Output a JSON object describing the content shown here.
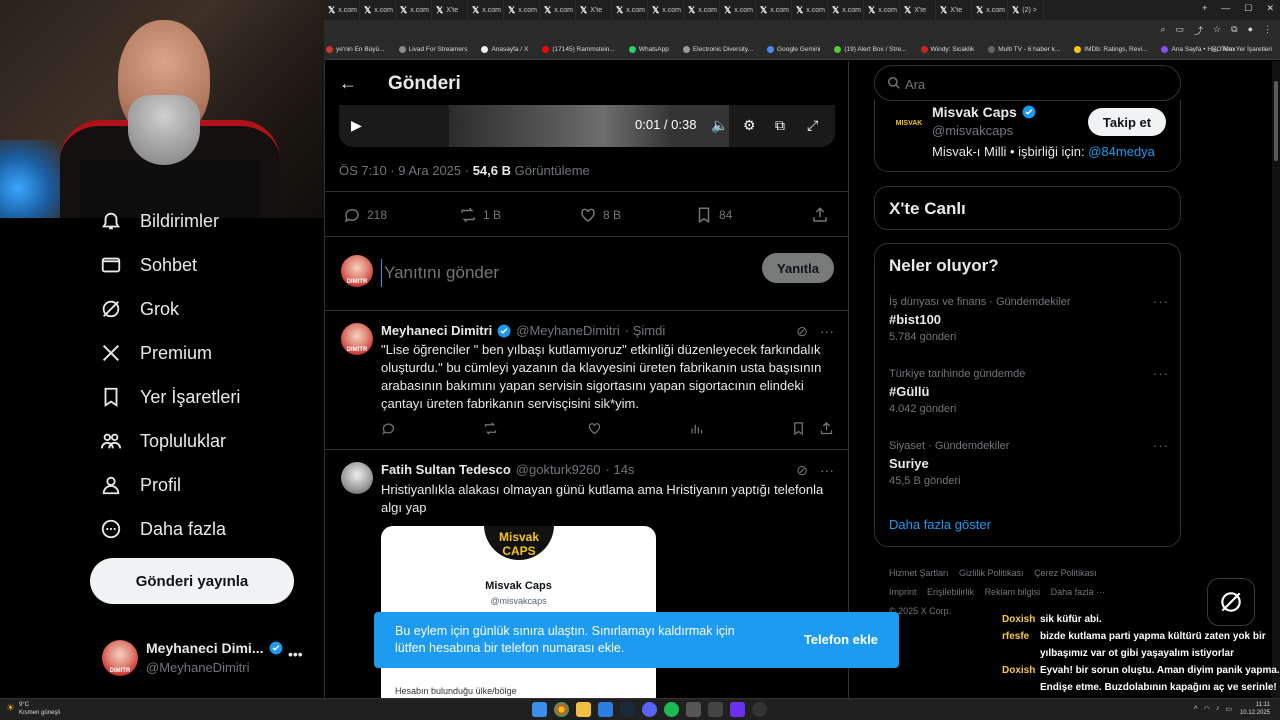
{
  "browser": {
    "tabs": [
      "x.com",
      "x.com",
      "x.com",
      "X'te",
      "x.com",
      "x.com",
      "x.com",
      "X'te",
      "x.com",
      "x.com",
      "x.com",
      "x.com",
      "x.com",
      "x.com",
      "x.com",
      "x.com",
      "X'te",
      "X'te",
      "x.com",
      "(2) >"
    ],
    "bookmarks": [
      "ye'nin En Büyü...",
      "Livad For Streamers",
      "Anasayfa / X",
      "(17145) Rammstein...",
      "WhatsApp",
      "Electronic Diversity...",
      "Google Gemini",
      "(19) Alert Box / Stre...",
      "Windy: Sicaklik",
      "Multi TV - 6 haber k...",
      "IMDb: Ratings, Revi...",
      "Ana Sayfa • HBO Max"
    ],
    "all_bookmarks": "Tüm Yer İşaretleri"
  },
  "sidebar": {
    "items": [
      {
        "label": "Bildirimler",
        "icon": "bell-icon"
      },
      {
        "label": "Sohbet",
        "icon": "mail-icon"
      },
      {
        "label": "Grok",
        "icon": "grok-icon"
      },
      {
        "label": "Premium",
        "icon": "x-logo-icon"
      },
      {
        "label": "Yer İşaretleri",
        "icon": "bookmark-icon"
      },
      {
        "label": "Topluluklar",
        "icon": "people-icon"
      },
      {
        "label": "Profil",
        "icon": "person-icon"
      },
      {
        "label": "Daha fazla",
        "icon": "more-circle-icon"
      }
    ],
    "post_button": "Gönderi yayınla",
    "account": {
      "name": "Meyhaneci Dimi...",
      "handle": "@MeyhaneDimitri"
    }
  },
  "main": {
    "title": "Gönderi",
    "video": {
      "time": "0:01 / 0:38"
    },
    "meta": {
      "time": "ÖS 7:10 · 9 Ara 2025 · ",
      "views_count": "54,6 B",
      "views_label": " Görüntüleme"
    },
    "stats": {
      "replies": "218",
      "reposts": "1 B",
      "likes": "8 B",
      "bookmarks": "84"
    },
    "reply": {
      "placeholder": "Yanıtını gönder",
      "button": "Yanıtla"
    },
    "tweets": [
      {
        "name": "Meyhaneci Dimitri",
        "handle": "@MeyhaneDimitri",
        "time": "· Şimdi",
        "text": "\"Lise öğrenciler \" ben yılbaşı kutlamıyoruz\" etkinliği düzenleyecek farkındalık oluşturdu.\" bu cümleyi yazanın da klavyesini üreten fabrikanın usta başısının arabasının bakımını yapan servisin sigortasını yapan sigortacının elindeki çantayı üreten fabrikanın servisçisini sik*yim."
      },
      {
        "name": "Fatih Sultan Tedesco",
        "handle": "@gokturk9260",
        "time": "· 14s",
        "text": "Hristiyanlıkla alakası olmayan günü kutlama ama Hristiyanın yaptığı telefonla algı yap",
        "embed": {
          "logo": "Misvak CAPS",
          "name": "Misvak Caps",
          "handle": "@misvakcaps",
          "field": "Hesabın bulunduğu ülke/bölge"
        }
      }
    ],
    "avatar_text": "DIMITR"
  },
  "right": {
    "search_placeholder": "Ara",
    "follow": {
      "name": "Misvak Caps",
      "handle": "@misvakcaps",
      "bio": "Misvak-ı Milli • işbirliği için: ",
      "bio_link": "@84medya",
      "button": "Takip et"
    },
    "live_title": "X'te Canlı",
    "trends_title": "Neler oluyor?",
    "trends": [
      {
        "category": "İş dünyası ve finans · Gündemdekiler",
        "name": "#bist100",
        "count": "5.784 gönderi"
      },
      {
        "category": "Türkiye tarihinde gündemde",
        "name": "#Güllü",
        "count": "4.042 gönderi"
      },
      {
        "category": "Siyaset · Gündemdekiler",
        "name": "Suriye",
        "count": "45,5 B gönderi"
      }
    ],
    "show_more": "Daha fazla göster",
    "footer": [
      "Hizmet Şartları",
      "Gizlilik Politikası",
      "Çerez Politikası",
      "Imprint",
      "Erişilebilirlik",
      "Reklam bilgisi",
      "Daha fazla ···",
      "© 2025 X Corp."
    ]
  },
  "toast": {
    "text": "Bu eylem için günlük sınıra ulaştın. Sınırlamayı kaldırmak için lütfen hesabına bir telefon numarası ekle.",
    "action": "Telefon ekle"
  },
  "chat": [
    {
      "user": "Doxish",
      "text": "sik küfür abi."
    },
    {
      "user": "rfesfe",
      "text": "bizde kutlama parti yapma kültürü zaten yok bir yılbaşımız var ot gibi yaşayalım istiyorlar"
    },
    {
      "user": "Doxish",
      "text": "Eyvah! bir sorun oluştu. Aman diyim panik yapma. Endişe etme. Buzdolabının kapağını aç ve serinle!"
    }
  ],
  "taskbar": {
    "weather_temp": "9°C",
    "weather_desc": "Kısmen güneşli",
    "time": "11:11",
    "date": "10.12.2025"
  },
  "colors": {
    "accent": "#1d9bf0",
    "border": "#2f3336",
    "muted": "#71767b",
    "chat_user": "#f6c84c"
  }
}
